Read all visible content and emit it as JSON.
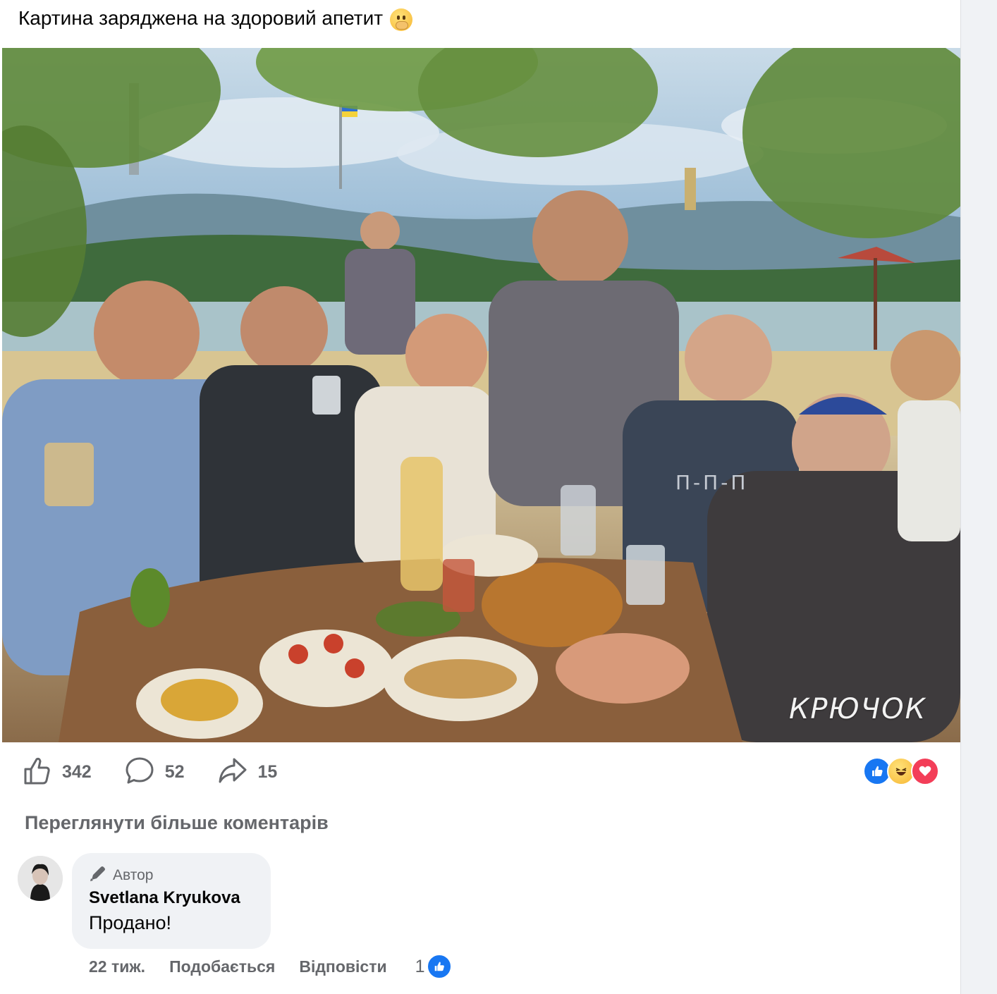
{
  "post": {
    "text": "Картина заряджена на здоровий апетит",
    "emoji": "face-with-hand-over-mouth-emoji"
  },
  "painting": {
    "signature": "КРЮЧОК",
    "shirt_text": "П-П-П"
  },
  "actions": {
    "likes": "342",
    "comments": "52",
    "shares": "15"
  },
  "reactions": [
    "like",
    "haha",
    "love"
  ],
  "more_comments_label": "Переглянути більше коментарів",
  "comment": {
    "badge": "Автор",
    "author": "Svetlana Kryukova",
    "text": "Продано!",
    "time": "22 тиж.",
    "like_label": "Подобається",
    "reply_label": "Відповісти",
    "like_count": "1"
  },
  "colors": {
    "facebook_blue": "#1877f2",
    "secondary_text": "#65676b",
    "bubble_bg": "#f0f2f5"
  }
}
